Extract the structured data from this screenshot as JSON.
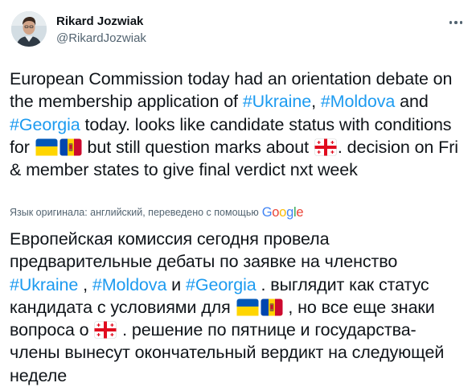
{
  "author": {
    "name": "Rikard Jozwiak",
    "handle": "@RikardJozwiak"
  },
  "tweet_original": {
    "t1": "European Commission today had an orientation debate on the membership application of ",
    "h_ukraine": "#Ukraine",
    "t2": ", ",
    "h_moldova": "#Moldova",
    "t3": " and ",
    "h_georgia": "#Georgia",
    "t4": " today. looks like candidate status with conditions for ",
    "t5": " but still question marks about ",
    "t6": ". decision on Fri & member states to give final verdict nxt week"
  },
  "translation_note": {
    "text": "Язык оригинала: английский, переведено с помощью",
    "provider": {
      "G1": "G",
      "o1": "o",
      "o2": "o",
      "g": "g",
      "l": "l",
      "e": "e"
    }
  },
  "tweet_translation": {
    "t1": "Европейская комиссия сегодня провела предварительные дебаты по заявке на членство ",
    "h_ukraine": "#Ukraine",
    "t2": " , ",
    "h_moldova": "#Moldova",
    "t3": " и ",
    "h_georgia": "#Georgia",
    "t4": " . выглядит как статус кандидата с условиями для ",
    "t5": " , но все еще знаки вопроса о ",
    "t6": " . решение по пятнице и государства-члены вынесут окончательный вердикт на следующей неделе"
  },
  "colors": {
    "text": "#0f1419",
    "secondary_text": "#536471",
    "hashtag": "#1d9bf0",
    "google_blue": "#4285F4",
    "google_red": "#EA4335",
    "google_yellow": "#FBBC05",
    "google_green": "#34A853"
  },
  "icons": [
    "avatar-photo",
    "more-options-icon",
    "ukraine-flag-icon",
    "moldova-flag-icon",
    "georgia-flag-icon",
    "google-logo"
  ]
}
